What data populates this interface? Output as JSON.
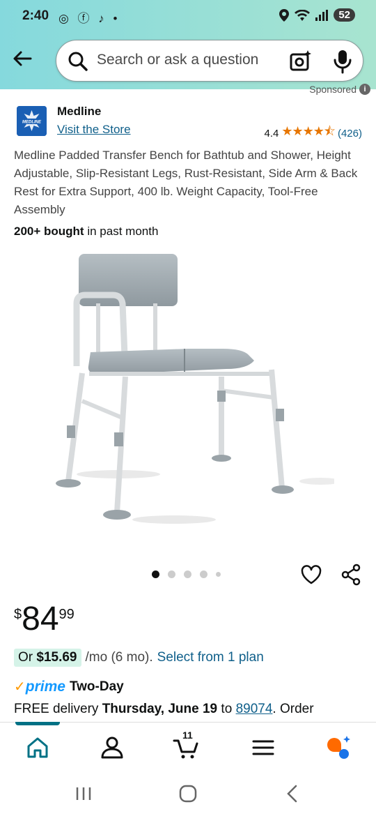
{
  "status_bar": {
    "time": "2:40",
    "left_icons": "◎ ⓕ ♪ •",
    "battery": "52"
  },
  "search": {
    "placeholder": "Search or ask a question"
  },
  "sponsored_label": "Sponsored",
  "brand": {
    "name": "Medline",
    "logo_text": "MEDLINE",
    "visit_store": "Visit the Store",
    "rating_value": "4.4",
    "review_count": "(426)"
  },
  "product": {
    "title": "Medline Padded Transfer Bench for Bathtub and Shower, Height Adjustable, Slip-Resistant Legs, Rust-Resistant, Side Arm & Back Rest for Extra Support, 400 lb. Weight Capacity, Tool-Free Assembly",
    "bought_count": "200+ bought",
    "bought_suffix": "in past month"
  },
  "carousel": {
    "total_dots": 5,
    "active_index": 0
  },
  "price": {
    "symbol": "$",
    "whole": "84",
    "fraction": "99"
  },
  "plan": {
    "prefix": "Or",
    "amount": "$15.69",
    "term": "/mo (6 mo).",
    "link": "Select from 1 plan"
  },
  "delivery": {
    "prime": "prime",
    "speed": "Two-Day",
    "free_text": "FREE delivery",
    "date": "Thursday, June 19",
    "to": "to",
    "zip": "89074",
    "suffix": ". Order"
  },
  "bottom_nav": {
    "cart_count": "11"
  },
  "colors": {
    "accent": "#007185",
    "link": "#0f5f8a",
    "star": "#e77600",
    "prime": "#1399ff"
  }
}
